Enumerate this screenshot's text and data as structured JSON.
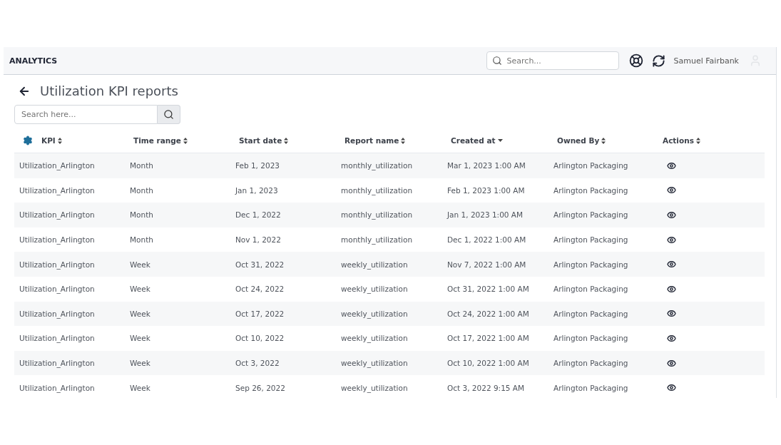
{
  "header": {
    "title": "ANALYTICS",
    "search": {
      "placeholder": "Search..."
    },
    "user": "Samuel Fairbank"
  },
  "page": {
    "title": "Utilization KPI reports",
    "search": {
      "placeholder": "Search here..."
    }
  },
  "table": {
    "columns": [
      {
        "label": "KPI",
        "sorted": false
      },
      {
        "label": "Time range",
        "sorted": false
      },
      {
        "label": "Start date",
        "sorted": false
      },
      {
        "label": "Report name",
        "sorted": false
      },
      {
        "label": "Created at",
        "sorted": true
      },
      {
        "label": "Owned By",
        "sorted": false
      },
      {
        "label": "Actions",
        "sorted": false
      }
    ],
    "rows": [
      [
        "Utilization_Arlington",
        "Month",
        "Feb 1, 2023",
        "monthly_utilization",
        "Mar 1, 2023 1:00 AM",
        "Arlington Packaging"
      ],
      [
        "Utilization_Arlington",
        "Month",
        "Jan 1, 2023",
        "monthly_utilization",
        "Feb 1, 2023 1:00 AM",
        "Arlington Packaging"
      ],
      [
        "Utilization_Arlington",
        "Month",
        "Dec 1, 2022",
        "monthly_utilization",
        "Jan 1, 2023 1:00 AM",
        "Arlington Packaging"
      ],
      [
        "Utilization_Arlington",
        "Month",
        "Nov 1, 2022",
        "monthly_utilization",
        "Dec 1, 2022 1:00 AM",
        "Arlington Packaging"
      ],
      [
        "Utilization_Arlington",
        "Week",
        "Oct 31, 2022",
        "weekly_utilization",
        "Nov 7, 2022 1:00 AM",
        "Arlington Packaging"
      ],
      [
        "Utilization_Arlington",
        "Week",
        "Oct 24, 2022",
        "weekly_utilization",
        "Oct 31, 2022 1:00 AM",
        "Arlington Packaging"
      ],
      [
        "Utilization_Arlington",
        "Week",
        "Oct 17, 2022",
        "weekly_utilization",
        "Oct 24, 2022 1:00 AM",
        "Arlington Packaging"
      ],
      [
        "Utilization_Arlington",
        "Week",
        "Oct 10, 2022",
        "weekly_utilization",
        "Oct 17, 2022 1:00 AM",
        "Arlington Packaging"
      ],
      [
        "Utilization_Arlington",
        "Week",
        "Oct 3, 2022",
        "weekly_utilization",
        "Oct 10, 2022 1:00 AM",
        "Arlington Packaging"
      ],
      [
        "Utilization_Arlington",
        "Week",
        "Sep 26, 2022",
        "weekly_utilization",
        "Oct 3, 2022 9:15 AM",
        "Arlington Packaging"
      ]
    ]
  }
}
